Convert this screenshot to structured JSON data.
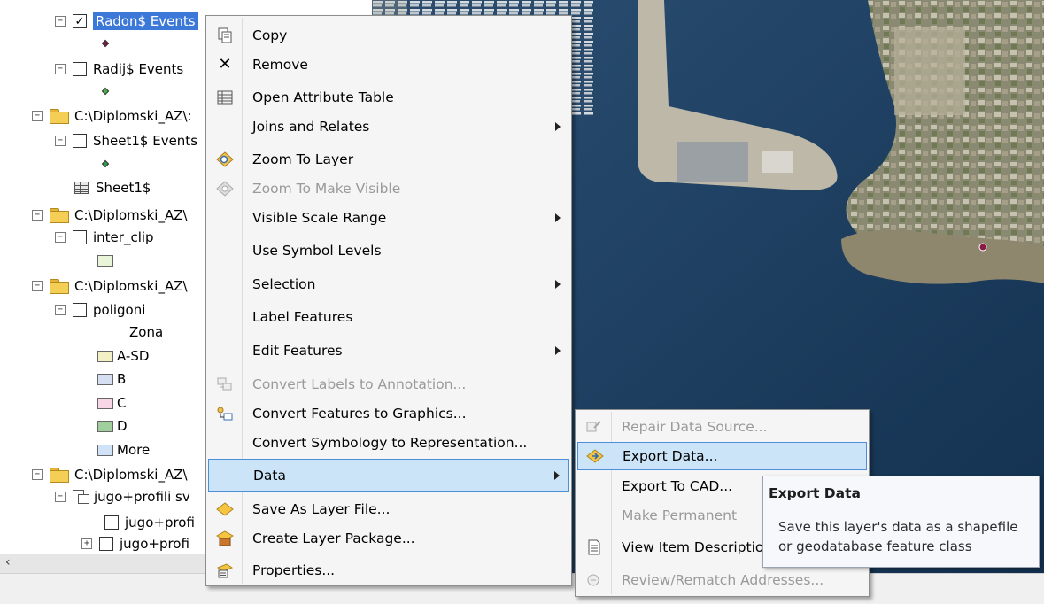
{
  "toc": {
    "layers": {
      "radon": "Radon$ Events",
      "radij": "Radij$ Events",
      "folder1": "C:\\Diplomski_AZ\\:",
      "sheet1_events": "Sheet1$ Events",
      "sheet1_table": "Sheet1$",
      "folder2": "C:\\Diplomski_AZ\\",
      "inter_clip": "inter_clip",
      "folder3": "C:\\Diplomski_AZ\\",
      "poligoni": "poligoni",
      "zona_heading": "Zona",
      "classes": [
        {
          "label": "A-SD",
          "color": "#f3f0c6"
        },
        {
          "label": "B",
          "color": "#d6dff2"
        },
        {
          "label": "C",
          "color": "#f7d6e6"
        },
        {
          "label": "D",
          "color": "#9fcf9a"
        },
        {
          "label": "More",
          "color": "#cfe2f7"
        }
      ],
      "folder4": "C:\\Diplomski_AZ\\",
      "group": "jugo+profili sv",
      "sub1": "jugo+profi",
      "sub2": "jugo+profi"
    },
    "colors": {
      "radon_symbol": "#7a1d4a",
      "radij_symbol": "#4caf50",
      "sheet_symbol": "#2e9a4a",
      "inter_clip_fill": "#e9f4d9"
    }
  },
  "context_menu": {
    "items": [
      {
        "label": "Copy",
        "icon": "copy-icon",
        "enabled": true
      },
      {
        "label": "Remove",
        "icon": "remove-icon",
        "enabled": true
      },
      {
        "label": "Open Attribute Table",
        "icon": "table-icon",
        "enabled": true
      },
      {
        "label": "Joins and Relates",
        "icon": "",
        "enabled": true,
        "submenu": true
      },
      {
        "label": "Zoom To Layer",
        "icon": "zoom-layer-icon",
        "enabled": true
      },
      {
        "label": "Zoom To Make Visible",
        "icon": "zoom-visible-icon",
        "enabled": false
      },
      {
        "label": "Visible Scale Range",
        "icon": "",
        "enabled": true,
        "submenu": true
      },
      {
        "label": "Use Symbol Levels",
        "icon": "",
        "enabled": true
      },
      {
        "label": "Selection",
        "icon": "",
        "enabled": true,
        "submenu": true
      },
      {
        "label": "Label Features",
        "icon": "",
        "enabled": true
      },
      {
        "label": "Edit Features",
        "icon": "",
        "enabled": true,
        "submenu": true
      },
      {
        "label": "Convert Labels to Annotation...",
        "icon": "convert-labels-icon",
        "enabled": false
      },
      {
        "label": "Convert Features to Graphics...",
        "icon": "convert-graphics-icon",
        "enabled": true
      },
      {
        "label": "Convert Symbology to Representation...",
        "icon": "",
        "enabled": true
      },
      {
        "label": "Data",
        "icon": "",
        "enabled": true,
        "submenu": true,
        "highlighted": true
      },
      {
        "label": "Save As Layer File...",
        "icon": "layer-file-icon",
        "enabled": true
      },
      {
        "label": "Create Layer Package...",
        "icon": "layer-package-icon",
        "enabled": true
      },
      {
        "label": "Properties...",
        "icon": "properties-icon",
        "enabled": true
      }
    ]
  },
  "data_submenu": {
    "items": [
      {
        "label": "Repair Data Source...",
        "icon": "repair-icon",
        "enabled": false
      },
      {
        "label": "Export Data...",
        "icon": "export-data-icon",
        "enabled": true,
        "highlighted": true
      },
      {
        "label": "Export To CAD...",
        "icon": "",
        "enabled": true
      },
      {
        "label": "Make Permanent",
        "icon": "",
        "enabled": false
      },
      {
        "label": "View Item Descriptio",
        "icon": "item-description-icon",
        "enabled": true
      },
      {
        "label": "Review/Rematch Addresses...",
        "icon": "rematch-icon",
        "enabled": false
      }
    ]
  },
  "tooltip": {
    "title": "Export Data",
    "body": "Save this layer's data as a shapefile or geodatabase feature class"
  },
  "map": {
    "point_color": "#8b1a4a"
  }
}
